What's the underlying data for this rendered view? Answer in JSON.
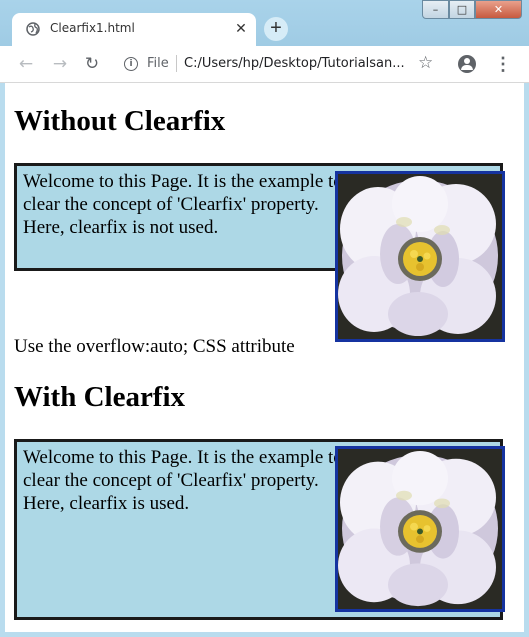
{
  "browser": {
    "tab_title": "Clearfix1.html",
    "tab_close": "✕",
    "new_tab": "+",
    "window_controls": {
      "minimize": "–",
      "maximize": "□",
      "close": "✕"
    },
    "nav": {
      "back": "←",
      "forward": "→",
      "reload": "↻"
    },
    "security_label": "File",
    "url": "C:/Users/hp/Desktop/Tutorialsan...",
    "icons": [
      "globe-icon",
      "close-icon",
      "plus-icon",
      "back-icon",
      "forward-icon",
      "reload-icon",
      "info-icon",
      "star-icon",
      "profile-icon",
      "menu-icon"
    ]
  },
  "page": {
    "heading_without": "Without Clearfix",
    "text_without": "Welcome to this Page. It is the example to clear the concept of 'Clearfix' property. Here, clearfix is not used.",
    "note": "Use the overflow:auto; CSS attribute",
    "heading_with": "With Clearfix",
    "text_with": "Welcome to this Page. It is the example to clear the concept of 'Clearfix' property. Here, clearfix is used.",
    "box_color": "#add8e6",
    "image_border_color": "#1533a0"
  }
}
